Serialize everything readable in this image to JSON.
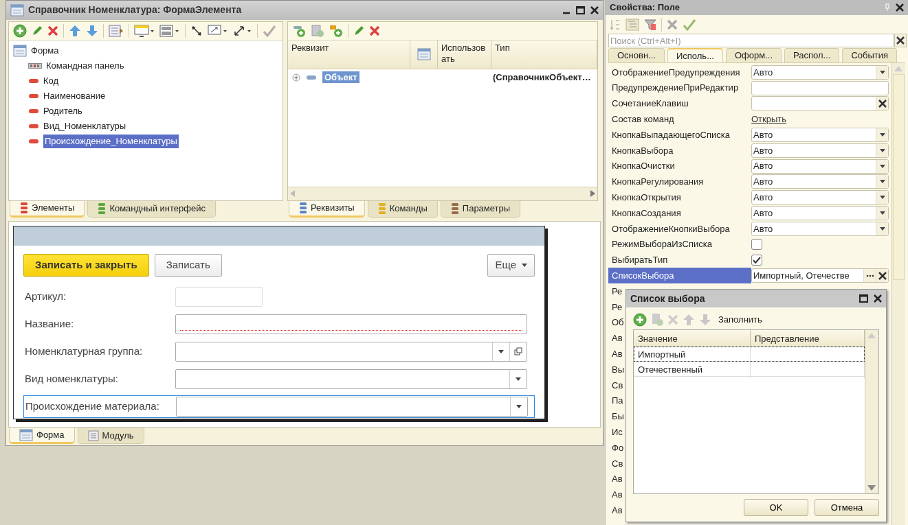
{
  "designer": {
    "title": "Справочник Номенклатура: ФормаЭлемента",
    "elements_tree": {
      "items": [
        {
          "label": "Форма",
          "kind": "form",
          "selected": false,
          "children": [
            {
              "label": "Командная панель",
              "kind": "command_bar",
              "selected": false
            },
            {
              "label": "Код",
              "kind": "field",
              "selected": false
            },
            {
              "label": "Наименование",
              "kind": "field",
              "selected": false
            },
            {
              "label": "Родитель",
              "kind": "field",
              "selected": false
            },
            {
              "label": "Вид_Номенклатуры",
              "kind": "field",
              "selected": false
            },
            {
              "label": "Происхождение_Номенклатуры",
              "kind": "field",
              "selected": true
            }
          ]
        }
      ]
    },
    "elements_tabs": [
      {
        "label": "Элементы",
        "selected": true,
        "color": "#d9453a"
      },
      {
        "label": "Командный интерфейс",
        "selected": false,
        "color": "#5aa83c"
      }
    ],
    "attributes_table": {
      "columns": [
        {
          "label": "Реквизит",
          "kind": "text"
        },
        {
          "kind": "icon"
        },
        {
          "label": "Использовать",
          "kind": "text"
        },
        {
          "label": "Тип",
          "kind": "text"
        }
      ],
      "rows": [
        {
          "name": "Объект",
          "type": "(СправочникОбъект…",
          "expanded": false,
          "selected": true
        }
      ]
    },
    "attributes_tabs": [
      {
        "label": "Реквизиты",
        "selected": true,
        "color": "#5b86c5"
      },
      {
        "label": "Команды",
        "selected": false,
        "color": "#e0b020"
      },
      {
        "label": "Параметры",
        "selected": false,
        "color": "#9a6a4a"
      }
    ],
    "form_preview": {
      "buttons": [
        {
          "label": "Записать и закрыть",
          "kind": "primary"
        },
        {
          "label": "Записать",
          "kind": "default"
        }
      ],
      "more_button": "Еще",
      "fields": [
        {
          "label": "Артикул:",
          "kind": "short",
          "focused": false
        },
        {
          "label": "Название:",
          "kind": "required",
          "focused": false
        },
        {
          "label": "Номенклатурная группа:",
          "kind": "select_open",
          "focused": false
        },
        {
          "label": "Вид номенклатуры:",
          "kind": "select",
          "focused": false
        },
        {
          "label": "Происхождение материала:",
          "kind": "select",
          "focused": true
        }
      ]
    },
    "bottom_tabs": [
      {
        "label": "Форма",
        "selected": true
      },
      {
        "label": "Модуль",
        "selected": false
      }
    ]
  },
  "properties": {
    "title": "Свойства: Поле",
    "search": {
      "placeholder": "Поиск (Ctrl+Alt+I)"
    },
    "tabs": [
      {
        "label": "Основн...",
        "selected": false
      },
      {
        "label": "Исполь...",
        "selected": true
      },
      {
        "label": "Оформ...",
        "selected": false
      },
      {
        "label": "Распол...",
        "selected": false
      },
      {
        "label": "События",
        "selected": false
      }
    ],
    "rows": [
      {
        "name": "ОтображениеПредупреждения",
        "kind": "select",
        "value": "Авто",
        "selected": false
      },
      {
        "name": "ПредупреждениеПриРедактир",
        "kind": "text",
        "selected": false
      },
      {
        "name": "СочетаниеКлавиш",
        "kind": "clearable",
        "selected": false
      },
      {
        "name": "Состав команд",
        "kind": "link",
        "value": "Открыть",
        "selected": false
      },
      {
        "name": "КнопкаВыпадающегоСписка",
        "kind": "select",
        "value": "Авто",
        "selected": false
      },
      {
        "name": "КнопкаВыбора",
        "kind": "select",
        "value": "Авто",
        "selected": false
      },
      {
        "name": "КнопкаОчистки",
        "kind": "select",
        "value": "Авто",
        "selected": false
      },
      {
        "name": "КнопкаРегулирования",
        "kind": "select",
        "value": "Авто",
        "selected": false
      },
      {
        "name": "КнопкаОткрытия",
        "kind": "select",
        "value": "Авто",
        "selected": false
      },
      {
        "name": "КнопкаСоздания",
        "kind": "select",
        "value": "Авто",
        "selected": false
      },
      {
        "name": "ОтображениеКнопкиВыбора",
        "kind": "select",
        "value": "Авто",
        "selected": false
      },
      {
        "name": "РежимВыбораИзСписка",
        "kind": "checkbox",
        "checked": false,
        "selected": false
      },
      {
        "name": "ВыбиратьТип",
        "kind": "checkbox",
        "checked": true,
        "selected": false
      },
      {
        "name": "СписокВыбора",
        "kind": "choice",
        "value": "Импортный, Отечестве",
        "selected": true
      },
      {
        "name": "Ре",
        "kind": "covered",
        "selected": false
      },
      {
        "name": "Ре",
        "kind": "covered",
        "selected": false
      },
      {
        "name": "Об",
        "kind": "covered",
        "selected": false
      },
      {
        "name": "Ав",
        "kind": "covered",
        "selected": false
      },
      {
        "name": "Ав",
        "kind": "covered",
        "selected": false
      },
      {
        "name": "Вы",
        "kind": "covered",
        "selected": false
      },
      {
        "name": "Св",
        "kind": "covered",
        "selected": false
      },
      {
        "name": "Па",
        "kind": "covered",
        "selected": false
      },
      {
        "name": "Бы",
        "kind": "covered",
        "selected": false
      },
      {
        "name": "Ис",
        "kind": "covered",
        "selected": false
      },
      {
        "name": "Фо",
        "kind": "covered",
        "selected": false
      },
      {
        "name": "Св",
        "kind": "covered",
        "selected": false
      },
      {
        "name": "Ав",
        "kind": "covered",
        "selected": false
      },
      {
        "name": "Ав",
        "kind": "covered",
        "selected": false
      },
      {
        "name": "Ав",
        "kind": "covered",
        "selected": false
      }
    ]
  },
  "choice_list_dialog": {
    "title": "Список выбора",
    "fill_button": "Заполнить",
    "columns": [
      "Значение",
      "Представление"
    ],
    "rows": [
      {
        "value": "Импортный",
        "selected": true
      },
      {
        "value": "Отечественный",
        "selected": false
      }
    ],
    "buttons": [
      "OK",
      "Отмена"
    ]
  }
}
